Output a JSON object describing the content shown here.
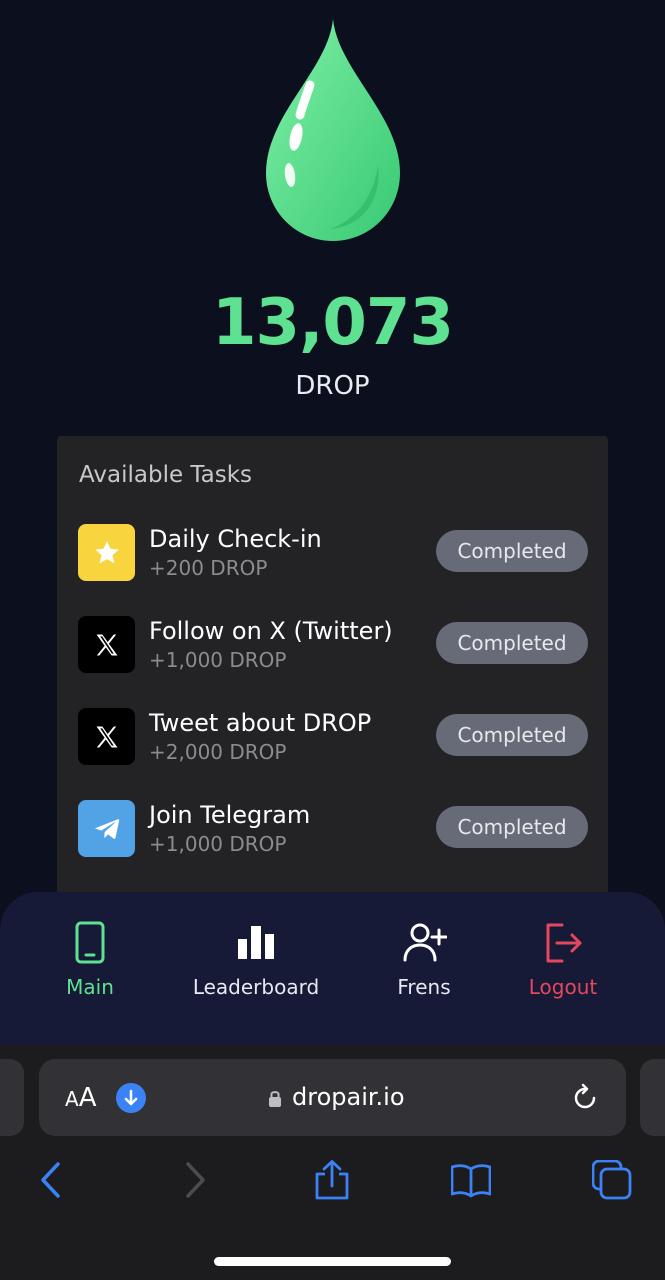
{
  "balance": {
    "amount": "13,073",
    "unit": "DROP"
  },
  "tasks": {
    "title": "Available Tasks",
    "items": [
      {
        "name": "Daily Check-in",
        "reward": "+200 DROP",
        "status": "Completed",
        "icon": "star-icon",
        "icon_color": "#f8d43e"
      },
      {
        "name": "Follow on X (Twitter)",
        "reward": "+1,000 DROP",
        "status": "Completed",
        "icon": "x-logo-icon",
        "icon_color": "#000000"
      },
      {
        "name": "Tweet about DROP",
        "reward": "+2,000 DROP",
        "status": "Completed",
        "icon": "x-logo-icon",
        "icon_color": "#000000"
      },
      {
        "name": "Join Telegram",
        "reward": "+1,000 DROP",
        "status": "Completed",
        "icon": "telegram-icon",
        "icon_color": "#52a3e6"
      }
    ]
  },
  "nav": {
    "main": "Main",
    "leaderboard": "Leaderboard",
    "frens": "Frens",
    "logout": "Logout",
    "active_color": "#5ee190",
    "logout_color": "#e5475e"
  },
  "browser": {
    "aa_small": "A",
    "aa_large": "A",
    "url": "dropair.io",
    "accent_color": "#3a82f6"
  },
  "colors": {
    "background": "#0b0f1e",
    "accent_green": "#5ee190",
    "card": "#232325",
    "status_pill": "#676b77"
  }
}
